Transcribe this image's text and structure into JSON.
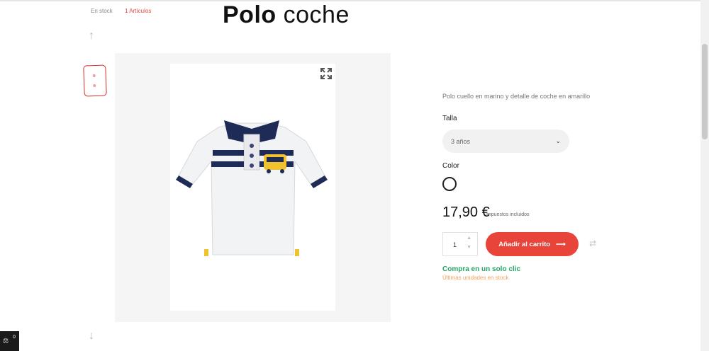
{
  "header": {
    "stock_label": "En stock",
    "articles_label": "1 Artículos",
    "title_bold": "Polo",
    "title_rest": "coche"
  },
  "nav": {
    "up_arrow": "↑",
    "down_arrow": "↓"
  },
  "product": {
    "description": "Polo cuello en marino y detalle de coche en amarillo",
    "size_label": "Talla",
    "size_selected": "3 años",
    "color_label": "Color",
    "price": "17,90 €",
    "tax_note": "Impuestos incluidos",
    "quantity": "1",
    "add_to_cart": "Añadir al carrito",
    "one_click": "Compra en un solo clic",
    "last_units": "Últimas unidades en stock"
  },
  "corner_widget": {
    "count": "0"
  },
  "colors": {
    "accent": "#e8443a",
    "green": "#28a466",
    "orange": "#f5a15c",
    "navy": "#1f2b57",
    "yellow": "#f2c12e"
  },
  "icons": [
    "expand-icon",
    "chevron-down-icon",
    "arrow-right-icon",
    "compare-icon",
    "scale-icon"
  ]
}
